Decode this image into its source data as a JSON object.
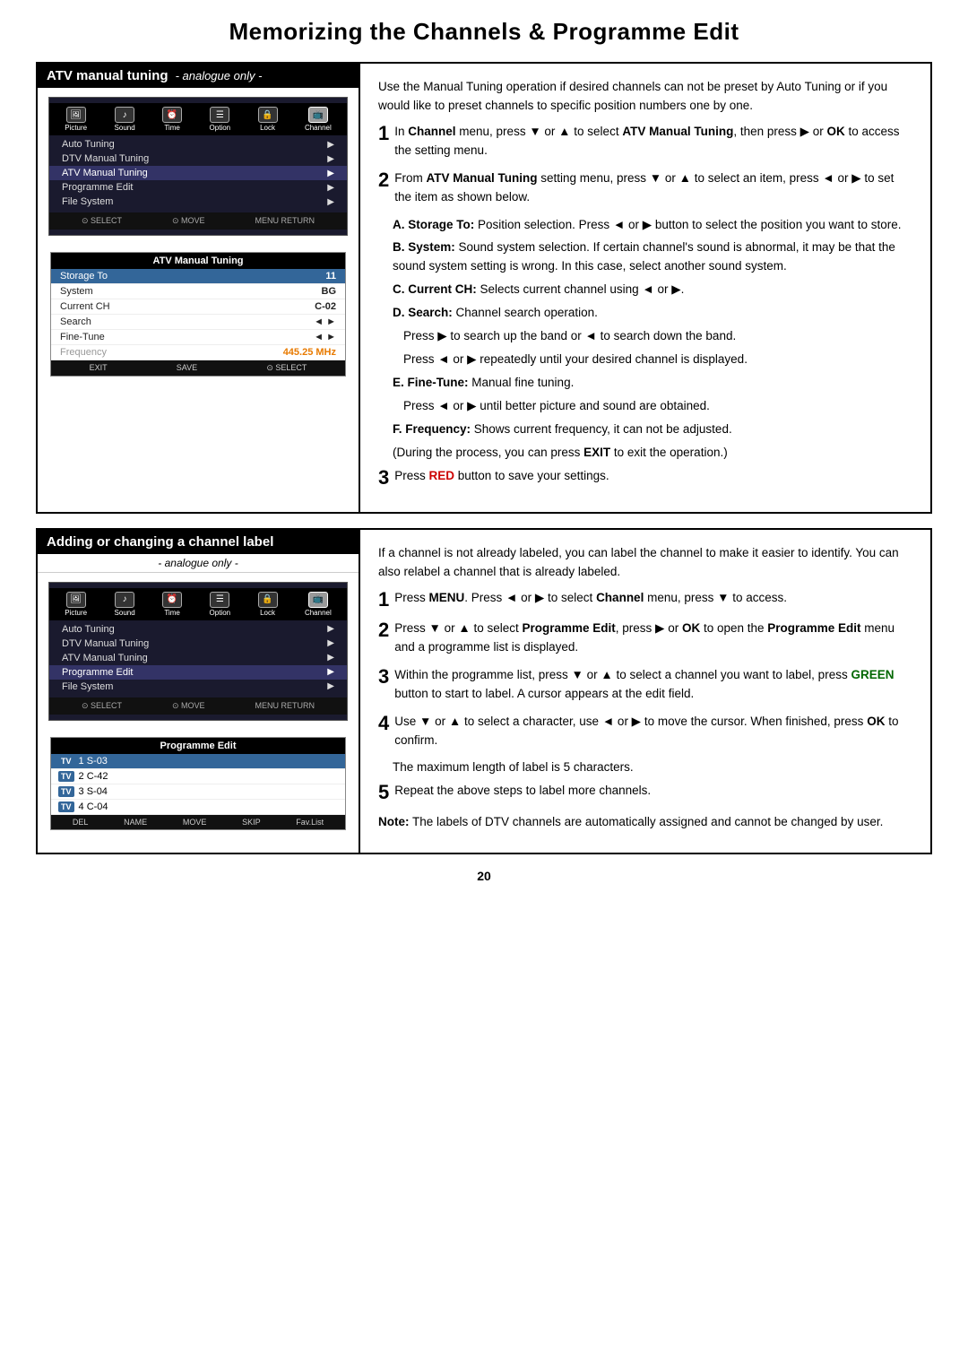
{
  "page": {
    "title": "Memorizing the Channels & Programme Edit",
    "page_number": "20"
  },
  "section1": {
    "header_label": "ATV manual tuning",
    "header_analogue": "- analogue only -",
    "menu": {
      "icons": [
        {
          "label": "Picture",
          "symbol": "🖼"
        },
        {
          "label": "Sound",
          "symbol": "♪"
        },
        {
          "label": "Time",
          "symbol": "⏰"
        },
        {
          "label": "Option",
          "symbol": "☰"
        },
        {
          "label": "Lock",
          "symbol": "🔒"
        },
        {
          "label": "Channel",
          "symbol": "📺",
          "active": true
        }
      ],
      "items": [
        {
          "label": "Auto Tuning",
          "arrow": "▶"
        },
        {
          "label": "DTV Manual Tuning",
          "arrow": "▶"
        },
        {
          "label": "ATV Manual Tuning",
          "arrow": "▶",
          "active": true
        },
        {
          "label": "Programme Edit",
          "arrow": "▶"
        },
        {
          "label": "File System",
          "arrow": "▶"
        }
      ],
      "footer": [
        "SELECT",
        "MOVE",
        "RETURN"
      ]
    },
    "sub_menu": {
      "title": "ATV Manual Tuning",
      "rows": [
        {
          "label": "Storage To",
          "value": "11",
          "highlight": true
        },
        {
          "label": "System",
          "value": "BG"
        },
        {
          "label": "Current CH",
          "value": "C-02"
        },
        {
          "label": "Search",
          "value": "◄ ►"
        },
        {
          "label": "Fine-Tune",
          "value": "◄ ►"
        },
        {
          "label": "Frequency",
          "value": "445.25 MHz",
          "freq": true
        }
      ],
      "footer": [
        "EXIT",
        "SAVE",
        "SELECT"
      ]
    },
    "right_intro": "Use the Manual Tuning operation if desired channels can not be preset by Auto Tuning or if you would like to preset channels to specific position numbers one by one.",
    "steps": [
      {
        "num": "1",
        "text": "In Channel menu, press ▼ or ▲ to select ATV Manual Tuning, then press ▶ or OK to access the setting menu."
      },
      {
        "num": "2",
        "text": "From ATV Manual Tuning setting menu, press ▼ or ▲ to select an item, press ◄ or ▶ to set the item as shown below."
      }
    ],
    "sub_items": [
      {
        "label": "A. Storage To:",
        "text": " Position selection. Press ◄ or ▶ button to select the position you want to store."
      },
      {
        "label": "B. System:",
        "text": " Sound system selection. If certain channel's sound is abnormal, it may be that the sound system setting is wrong. In this case, select another sound system."
      },
      {
        "label": "C. Current CH:",
        "text": " Selects current channel using ◄ or ▶."
      },
      {
        "label": "D. Search:",
        "text": " Channel search operation."
      },
      {
        "label": "D_sub1",
        "text": "Press ▶ to search up the band or ◄ to search down the band."
      },
      {
        "label": "D_sub2",
        "text": "Press ◄ or ▶ repeatedly until your desired channel is displayed."
      },
      {
        "label": "E. Fine-Tune:",
        "text": " Manual fine tuning."
      },
      {
        "label": "E_sub1",
        "text": "Press ◄ or ▶ until better picture and sound are obtained."
      },
      {
        "label": "F. Frequency:",
        "text": " Shows current frequency, it can not be adjusted."
      },
      {
        "label": "exit_note",
        "text": "(During the process, you can press EXIT to exit the operation.)"
      }
    ],
    "step3": {
      "num": "3",
      "text": "Press RED button to save your settings."
    }
  },
  "section2": {
    "header_label": "Adding or changing a channel label",
    "header_analogue": "- analogue only -",
    "menu": {
      "icons": [
        {
          "label": "Picture",
          "symbol": "🖼"
        },
        {
          "label": "Sound",
          "symbol": "♪"
        },
        {
          "label": "Time",
          "symbol": "⏰"
        },
        {
          "label": "Option",
          "symbol": "☰"
        },
        {
          "label": "Lock",
          "symbol": "🔒"
        },
        {
          "label": "Channel",
          "symbol": "📺",
          "active": true
        }
      ],
      "items": [
        {
          "label": "Auto Tuning",
          "arrow": "▶"
        },
        {
          "label": "DTV Manual Tuning",
          "arrow": "▶"
        },
        {
          "label": "ATV Manual Tuning",
          "arrow": "▶"
        },
        {
          "label": "Programme Edit",
          "arrow": "▶",
          "active": true
        },
        {
          "label": "File System",
          "arrow": "▶"
        }
      ],
      "footer": [
        "SELECT",
        "MOVE",
        "RETURN"
      ]
    },
    "prog_edit": {
      "title": "Programme Edit",
      "rows": [
        {
          "badge": "TV",
          "label": "1  S-03",
          "selected": true
        },
        {
          "badge": "TV",
          "label": "2  C-42"
        },
        {
          "badge": "TV",
          "label": "3  S-04"
        },
        {
          "badge": "TV",
          "label": "4  C-04"
        }
      ],
      "footer": [
        "DEL",
        "NAME",
        "MOVE",
        "SKIP",
        "Fav.List"
      ]
    },
    "right_intro": "If a channel is not already labeled, you can label the channel to make it easier to identify. You can also relabel a channel that is already labeled.",
    "steps": [
      {
        "num": "1",
        "text": "Press MENU. Press ◄ or ▶ to select Channel menu, press ▼ to access."
      },
      {
        "num": "2",
        "text": "Press ▼ or ▲ to select Programme Edit, press ▶ or OK to open the Programme Edit menu and a programme list is displayed."
      },
      {
        "num": "3",
        "text": "Within the programme list, press ▼ or ▲ to select a channel you want to label, press GREEN button to start to label. A cursor appears at the edit field."
      },
      {
        "num": "4",
        "text": "Use ▼ or ▲ to select a character, use ◄ or ▶ to move the cursor. When finished, press OK to confirm."
      },
      {
        "num": "4b",
        "text": "The maximum length of label is 5 characters."
      },
      {
        "num": "5",
        "text": "Repeat the above steps to label more channels."
      }
    ],
    "note": "Note: The labels of DTV channels are automatically assigned and cannot be changed by user."
  }
}
